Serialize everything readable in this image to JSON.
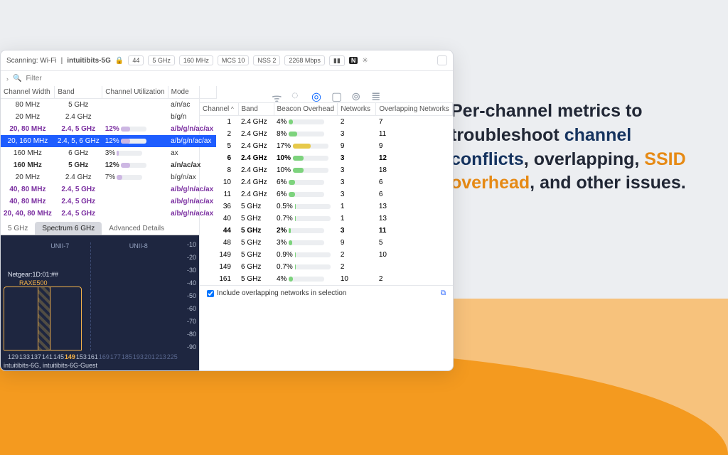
{
  "titlebar": {
    "scanning": "Scanning: Wi-Fi",
    "ssid": "intuitibits-5G",
    "chips": [
      "44",
      "5 GHz",
      "160 MHz",
      "MCS 10",
      "NSS 2",
      "2268 Mbps"
    ]
  },
  "filter": {
    "placeholder": "Filter"
  },
  "left_headers": [
    "Channel Width",
    "Band",
    "Channel Utilization",
    "Mode"
  ],
  "left_rows": [
    {
      "w": "80 MHz",
      "b": "5 GHz",
      "u": null,
      "m": "a/n/ac",
      "style": ""
    },
    {
      "w": "20 MHz",
      "b": "2.4 GHz",
      "u": null,
      "m": "b/g/n",
      "style": ""
    },
    {
      "w": "20, 80 MHz",
      "b": "2.4, 5 GHz",
      "u": 12,
      "m": "a/b/g/n/ac/ax",
      "style": "purple"
    },
    {
      "w": "20, 160 MHz",
      "b": "2.4, 5, 6 GHz",
      "u": 12,
      "m": "a/b/g/n/ac/ax",
      "style": "sel"
    },
    {
      "w": "160 MHz",
      "b": "6 GHz",
      "u": 3,
      "m": "ax",
      "style": ""
    },
    {
      "w": "160 MHz",
      "b": "5 GHz",
      "u": 12,
      "m": "a/n/ac/ax",
      "style": "bold"
    },
    {
      "w": "20 MHz",
      "b": "2.4 GHz",
      "u": 7,
      "m": "b/g/n/ax",
      "style": ""
    },
    {
      "w": "40, 80 MHz",
      "b": "2.4, 5 GHz",
      "u": null,
      "m": "a/b/g/n/ac/ax",
      "style": "purple"
    },
    {
      "w": "40, 80 MHz",
      "b": "2.4, 5 GHz",
      "u": null,
      "m": "a/b/g/n/ac/ax",
      "style": "purple"
    },
    {
      "w": "20, 40, 80 MHz",
      "b": "2.4, 5 GHz",
      "u": null,
      "m": "a/b/g/n/ac/ax",
      "style": "purple"
    }
  ],
  "right_headers": [
    "Channel",
    "Band",
    "Beacon Overhead",
    "Networks",
    "Overlapping Networks"
  ],
  "right_rows": [
    {
      "ch": 1,
      "b": "2.4 GHz",
      "o": "4%",
      "ov": 4,
      "n": 2,
      "on": 7,
      "bold": false,
      "c": "g"
    },
    {
      "ch": 2,
      "b": "2.4 GHz",
      "o": "8%",
      "ov": 8,
      "n": 3,
      "on": 11,
      "bold": false,
      "c": "g"
    },
    {
      "ch": 5,
      "b": "2.4 GHz",
      "o": "17%",
      "ov": 17,
      "n": 9,
      "on": 9,
      "bold": false,
      "c": "y"
    },
    {
      "ch": 6,
      "b": "2.4 GHz",
      "o": "10%",
      "ov": 10,
      "n": 3,
      "on": 12,
      "bold": true,
      "c": "g"
    },
    {
      "ch": 8,
      "b": "2.4 GHz",
      "o": "10%",
      "ov": 10,
      "n": 3,
      "on": 18,
      "bold": false,
      "c": "g"
    },
    {
      "ch": 10,
      "b": "2.4 GHz",
      "o": "6%",
      "ov": 6,
      "n": 3,
      "on": 6,
      "bold": false,
      "c": "g"
    },
    {
      "ch": 11,
      "b": "2.4 GHz",
      "o": "6%",
      "ov": 6,
      "n": 3,
      "on": 6,
      "bold": false,
      "c": "g"
    },
    {
      "ch": 36,
      "b": "5 GHz",
      "o": "0.5%",
      "ov": 1,
      "n": 1,
      "on": 13,
      "bold": false,
      "c": "g"
    },
    {
      "ch": 40,
      "b": "5 GHz",
      "o": "0.7%",
      "ov": 1,
      "n": 1,
      "on": 13,
      "bold": false,
      "c": "g"
    },
    {
      "ch": 44,
      "b": "5 GHz",
      "o": "2%",
      "ov": 2,
      "n": 3,
      "on": 11,
      "bold": true,
      "c": "g"
    },
    {
      "ch": 48,
      "b": "5 GHz",
      "o": "3%",
      "ov": 3,
      "n": 9,
      "on": 5,
      "bold": false,
      "c": "g"
    },
    {
      "ch": 149,
      "b": "5 GHz",
      "o": "0.9%",
      "ov": 1,
      "n": 2,
      "on": 10,
      "bold": false,
      "c": "g"
    },
    {
      "ch": 149,
      "b": "6 GHz",
      "o": "0.7%",
      "ov": 1,
      "n": 2,
      "on": "",
      "bold": false,
      "c": "g"
    },
    {
      "ch": 161,
      "b": "5 GHz",
      "o": "4%",
      "ov": 4,
      "n": 10,
      "on": 2,
      "bold": false,
      "c": "g"
    }
  ],
  "tabs": [
    "5 GHz",
    "Spectrum 6 GHz",
    "Advanced Details"
  ],
  "active_tab": 1,
  "spectrum": {
    "yticks": [
      "-10",
      "-20",
      "-30",
      "-40",
      "-50",
      "-60",
      "-70",
      "-80",
      "-90"
    ],
    "xticks": [
      "129",
      "133",
      "137",
      "141",
      "145",
      "149",
      "153",
      "161",
      "169",
      "177",
      "185",
      "193",
      "201",
      "213",
      "225"
    ],
    "unii7": "UNII-7",
    "unii8": "UNII-8",
    "netlabel1": "Netgear:1D:01:##",
    "netlabel2": "RAXE500",
    "ssids": "intuitibits-6G, intuitibits-6G-Guest"
  },
  "foot": {
    "checkbox_label": "Include overlapping networks in selection"
  },
  "promo": {
    "t1": "Per-channel metrics to troubleshoot ",
    "hl1": "channel conflicts",
    "t2": ", overlapping, ",
    "hl2": "SSID overhead",
    "t3": ", and other issues."
  }
}
